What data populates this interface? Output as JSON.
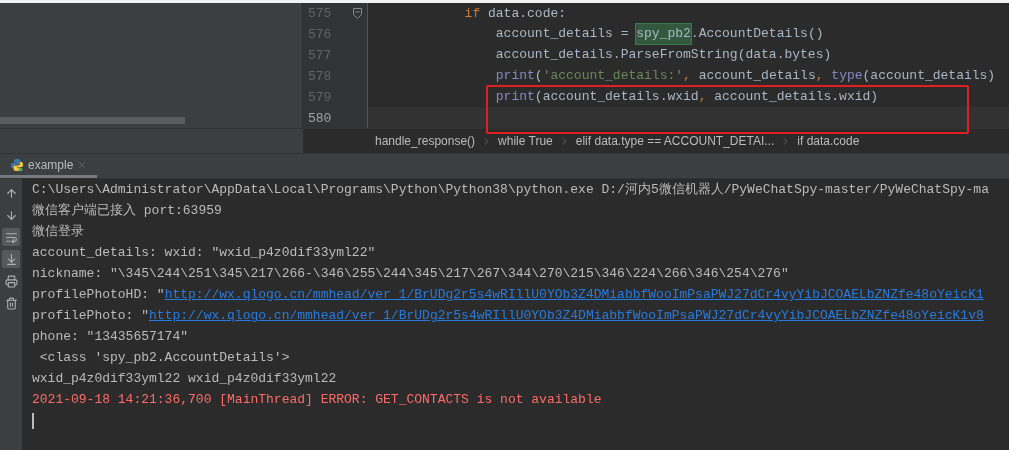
{
  "editor": {
    "lines": [
      {
        "number": "575",
        "fold": true,
        "current": false,
        "boxed": false,
        "tokens": [
          {
            "kind": "keyword",
            "text": "            if"
          },
          {
            "kind": "plain",
            "text": " data.code:"
          }
        ]
      },
      {
        "number": "576",
        "fold": false,
        "current": false,
        "boxed": false,
        "tokens": [
          {
            "kind": "plain",
            "text": "                account_details = "
          },
          {
            "kind": "match",
            "text": "spy_pb2"
          },
          {
            "kind": "plain",
            "text": ".AccountDetails()"
          }
        ]
      },
      {
        "number": "577",
        "fold": false,
        "current": false,
        "boxed": false,
        "tokens": [
          {
            "kind": "plain",
            "text": "                account_details.ParseFromString(data.bytes)"
          }
        ]
      },
      {
        "number": "578",
        "fold": false,
        "current": false,
        "boxed": false,
        "tokens": [
          {
            "kind": "builtin",
            "text": "                print"
          },
          {
            "kind": "plain",
            "text": "("
          },
          {
            "kind": "string",
            "text": "'account_details:'"
          },
          {
            "kind": "keyword",
            "text": ","
          },
          {
            "kind": "plain",
            "text": " account_details"
          },
          {
            "kind": "keyword",
            "text": ", "
          },
          {
            "kind": "builtin",
            "text": "type"
          },
          {
            "kind": "plain",
            "text": "(account_details)"
          }
        ]
      },
      {
        "number": "579",
        "fold": false,
        "current": false,
        "boxed": true,
        "tokens": [
          {
            "kind": "builtin",
            "text": "                print"
          },
          {
            "kind": "plain",
            "text": "(account_details.wxid"
          },
          {
            "kind": "keyword",
            "text": ","
          },
          {
            "kind": "plain",
            "text": " account_details.wxid)"
          }
        ]
      },
      {
        "number": "580",
        "fold": false,
        "current": true,
        "boxed": true
      }
    ],
    "breadcrumbs": [
      "handle_response()",
      "while True",
      "elif data.type == ACCOUNT_DETAI...",
      "if data.code"
    ]
  },
  "run_tab": {
    "label": "example",
    "selected": true
  },
  "toolbar": [
    {
      "kind": "up",
      "on": false
    },
    {
      "kind": "down",
      "on": false
    },
    {
      "kind": "wrap",
      "on": true
    },
    {
      "kind": "scroll-end",
      "on": true
    },
    {
      "kind": "print",
      "on": false
    },
    {
      "kind": "delete",
      "on": false
    }
  ],
  "console": [
    {
      "kind": "plain",
      "text": "C:\\Users\\Administrator\\AppData\\Local\\Programs\\Python\\Python38\\python.exe D:/河内5微信机器人/PyWeChatSpy-master/PyWeChatSpy-ma"
    },
    {
      "kind": "plain",
      "text": "微信客户端已接入 port:63959"
    },
    {
      "kind": "plain",
      "text": "微信登录"
    },
    {
      "kind": "plain",
      "text": "account_details: wxid: \"wxid_p4z0dif33yml22\""
    },
    {
      "kind": "plain",
      "text": "nickname: \"\\345\\244\\251\\345\\217\\266-\\346\\255\\244\\345\\217\\267\\344\\270\\215\\346\\224\\266\\346\\254\\276\""
    },
    {
      "kind": "link",
      "text": "profilePhotoHD: \"",
      "link": "http://wx.qlogo.cn/mmhead/ver_1/BrUDg2r5s4wRIllU0YOb3Z4DMiabbfWooImPsaPWJ27dCr4vyYibJCOAELbZNZfe48oYeicK1"
    },
    {
      "kind": "link",
      "text": "profilePhoto: \"",
      "link": "http://wx.qlogo.cn/mmhead/ver_1/BrUDg2r5s4wRIllU0YOb3Z4DMiabbfWooImPsaPWJ27dCr4vyYibJCOAELbZNZfe48oYeicK1v8"
    },
    {
      "kind": "plain",
      "text": "phone: \"13435657174\""
    },
    {
      "kind": "plain",
      "text": " <class 'spy_pb2.AccountDetails'>"
    },
    {
      "kind": "plain",
      "text": "wxid_p4z0dif33yml22 wxid_p4z0dif33yml22"
    },
    {
      "kind": "error",
      "text": "2021-09-18 14:21:36,700 [MainThread] ERROR: GET_CONTACTS is not available"
    },
    {
      "kind": "cursor"
    }
  ]
}
